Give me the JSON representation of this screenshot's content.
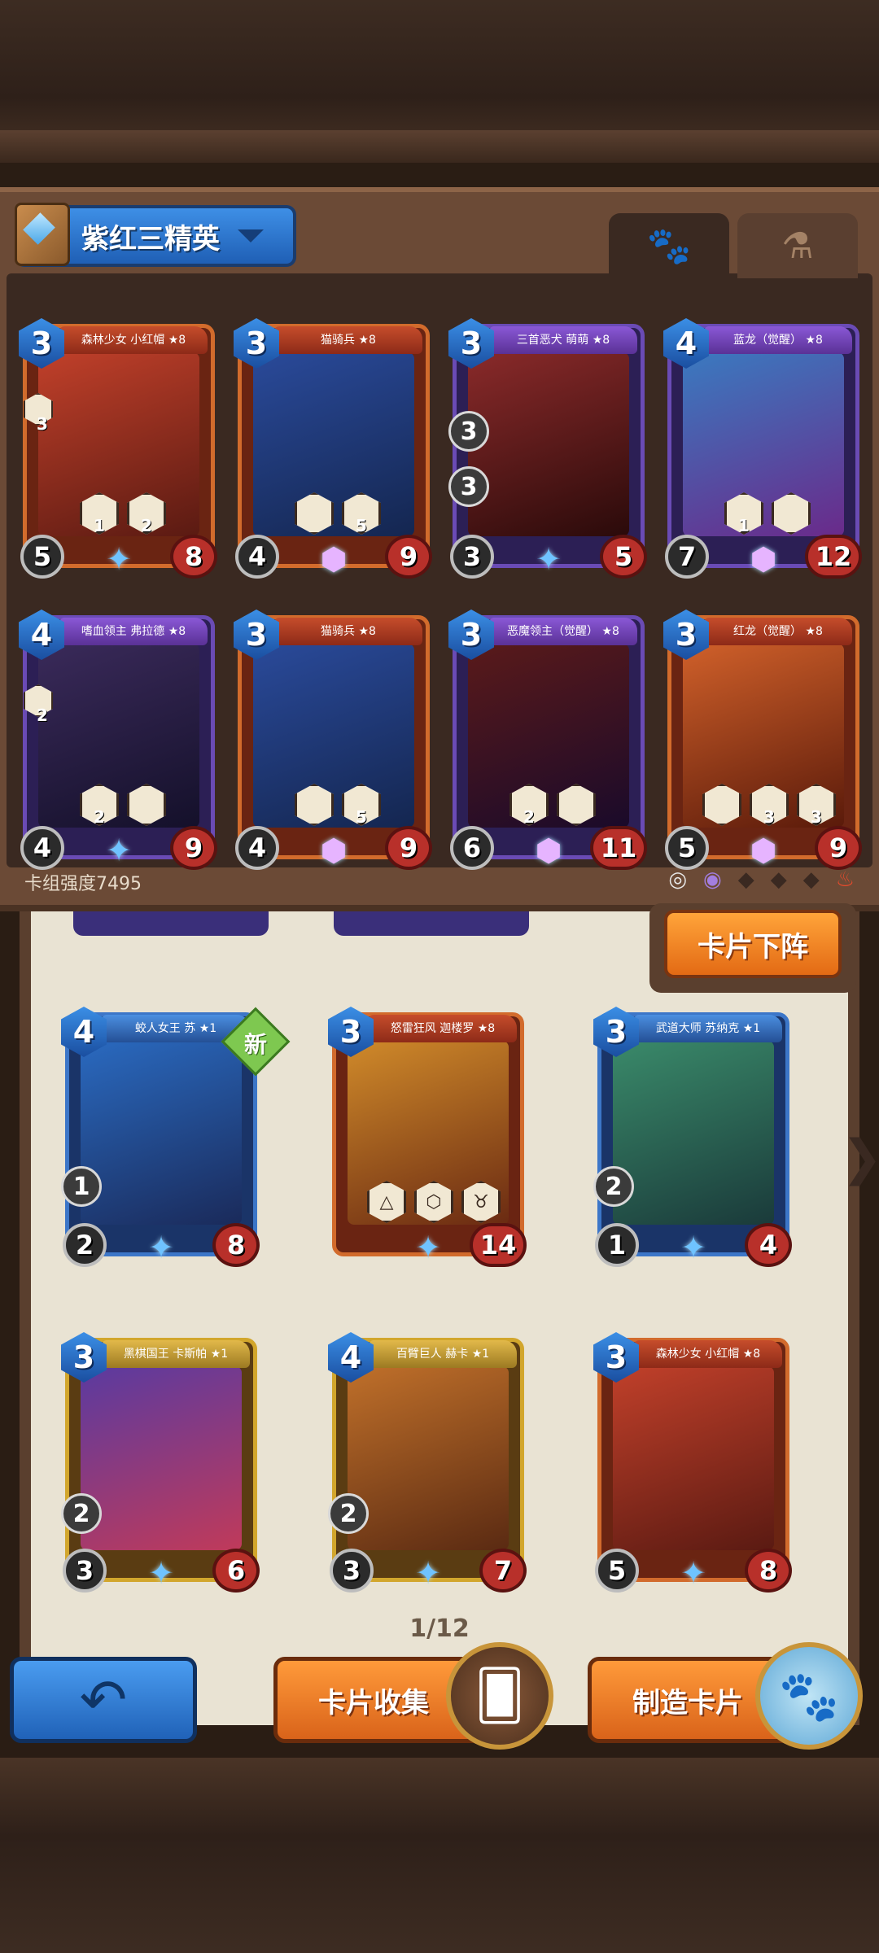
{
  "deck": {
    "name": "紫红三精英",
    "strength_label": "卡组强度7495",
    "tabs": [
      {
        "icon": "paw-icon",
        "active": true
      },
      {
        "icon": "potion-icon",
        "active": false
      }
    ],
    "cards": [
      {
        "name": "森林少女 小红帽 ★8",
        "cost": "3",
        "attack": "5",
        "health": "8",
        "abilities": [
          "1",
          "2"
        ],
        "side_badge": "3",
        "color": "orange"
      },
      {
        "name": "猫骑兵 ★8",
        "cost": "3",
        "attack": "4",
        "health": "9",
        "abilities": [
          "",
          "5"
        ],
        "side_badge": "",
        "color": "orange"
      },
      {
        "name": "三首恶犬 萌萌 ★8",
        "cost": "3",
        "attack": "3",
        "health": "5",
        "abilities": [],
        "side_badge": "3",
        "extra_num": "3",
        "color": "purple"
      },
      {
        "name": "蓝龙（觉醒） ★8",
        "cost": "4",
        "attack": "7",
        "health": "12",
        "abilities": [
          "1",
          ""
        ],
        "side_badge": "",
        "color": "purple"
      },
      {
        "name": "嗜血领主 弗拉德 ★8",
        "cost": "4",
        "attack": "4",
        "health": "9",
        "abilities": [
          "2",
          ""
        ],
        "side_badge": "2",
        "color": "purple"
      },
      {
        "name": "猫骑兵 ★8",
        "cost": "3",
        "attack": "4",
        "health": "9",
        "abilities": [
          "",
          "5"
        ],
        "side_badge": "",
        "color": "orange"
      },
      {
        "name": "恶魔领主（觉醒） ★8",
        "cost": "3",
        "attack": "6",
        "health": "11",
        "abilities": [
          "2",
          ""
        ],
        "side_badge": "",
        "color": "purple"
      },
      {
        "name": "红龙（觉醒） ★8",
        "cost": "3",
        "attack": "5",
        "health": "9",
        "abilities": [
          "",
          "3",
          "3"
        ],
        "side_badge": "",
        "color": "orange"
      }
    ]
  },
  "actions": {
    "remove_card": "卡片下阵",
    "back_icon": "back-arrow-icon",
    "collect": "卡片收集",
    "craft": "制造卡片"
  },
  "collection": {
    "new_label": "新",
    "page": "1/12",
    "cards": [
      {
        "name": "蛟人女王 苏 ★1",
        "cost": "4",
        "attack": "2",
        "health": "8",
        "extra_num": "1",
        "color": "blue"
      },
      {
        "name": "怒雷狂风 迦楼罗 ★8",
        "cost": "3",
        "attack": "",
        "health": "14",
        "extra_num": "",
        "color": "orange"
      },
      {
        "name": "武道大师 苏纳克 ★1",
        "cost": "3",
        "attack": "1",
        "health": "4",
        "extra_num": "2",
        "color": "blue"
      },
      {
        "name": "黑棋国王 卡斯帕 ★1",
        "cost": "3",
        "attack": "3",
        "health": "6",
        "extra_num": "2",
        "color": "yellow"
      },
      {
        "name": "百臂巨人 赫卡 ★1",
        "cost": "4",
        "attack": "3",
        "health": "7",
        "extra_num": "2",
        "color": "yellow"
      },
      {
        "name": "森林少女 小红帽 ★8",
        "cost": "3",
        "attack": "5",
        "health": "8",
        "extra_num": "",
        "color": "orange"
      }
    ]
  }
}
